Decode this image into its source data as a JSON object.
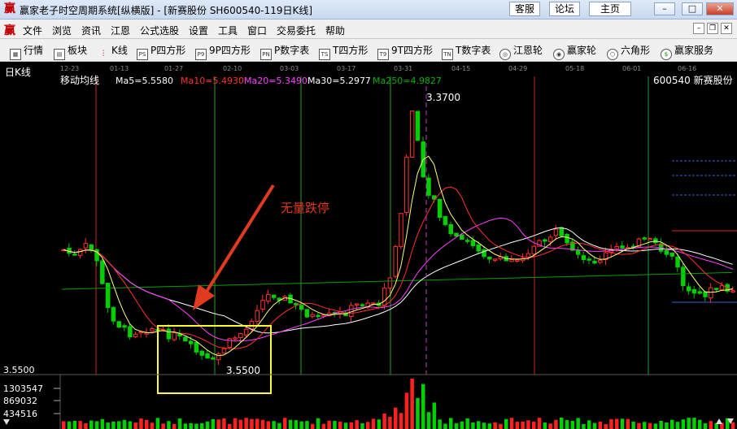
{
  "window": {
    "app_title": "赢家老子时空周期系统[纵横版] - [新赛股份   SH600540-119日K线]",
    "buttons": [
      "客服",
      "论坛",
      "主页"
    ]
  },
  "menu": [
    "文件",
    "浏览",
    "资讯",
    "江恩",
    "公式选股",
    "设置",
    "工具",
    "窗口",
    "交易委托",
    "帮助"
  ],
  "toolbar": [
    {
      "label": "行情",
      "icon": "grid-icon"
    },
    {
      "label": "板块",
      "icon": "sector-icon"
    },
    {
      "label": "K线",
      "icon": "kline-icon"
    },
    {
      "label": "P四方形",
      "icon": "ps-icon"
    },
    {
      "label": "9P四方形",
      "icon": "p9-icon"
    },
    {
      "label": "P数字表",
      "icon": "pn-icon"
    },
    {
      "label": "T四方形",
      "icon": "ts-icon"
    },
    {
      "label": "9T四方形",
      "icon": "t9-icon"
    },
    {
      "label": "T数字表",
      "icon": "tn-icon"
    },
    {
      "label": "江恩轮",
      "icon": "gann-wheel-icon"
    },
    {
      "label": "赢家轮",
      "icon": "winner-wheel-icon"
    },
    {
      "label": "六角形",
      "icon": "hexagon-icon"
    },
    {
      "label": "赢家服务",
      "icon": "dollar-icon"
    }
  ],
  "chart": {
    "period_label": "日K线",
    "indicator_name": "移动均线",
    "ma": [
      {
        "label": "Ma5=5.5580",
        "color": "#ffffff"
      },
      {
        "label": "Ma10=5.4930",
        "color": "#ff3030"
      },
      {
        "label": "Ma20=5.3490",
        "color": "#ff40ff"
      },
      {
        "label": "Ma30=5.2977",
        "color": "#ffffff"
      },
      {
        "label": "Ma250=4.9827",
        "color": "#00b000"
      }
    ],
    "stock": "600540 新赛股份",
    "dates": [
      "12-23",
      "01-13",
      "01-27",
      "02-10",
      "03-03",
      "03-17",
      "03-31",
      "04-15",
      "04-29",
      "05-18",
      "06-01",
      "06-16"
    ],
    "high_label": "3.3700",
    "low_label": "3.5500",
    "axis_low": "3.5500",
    "annotation": "无量跌停",
    "volume_ticks": [
      "1303547",
      "869032",
      "434516"
    ]
  }
}
